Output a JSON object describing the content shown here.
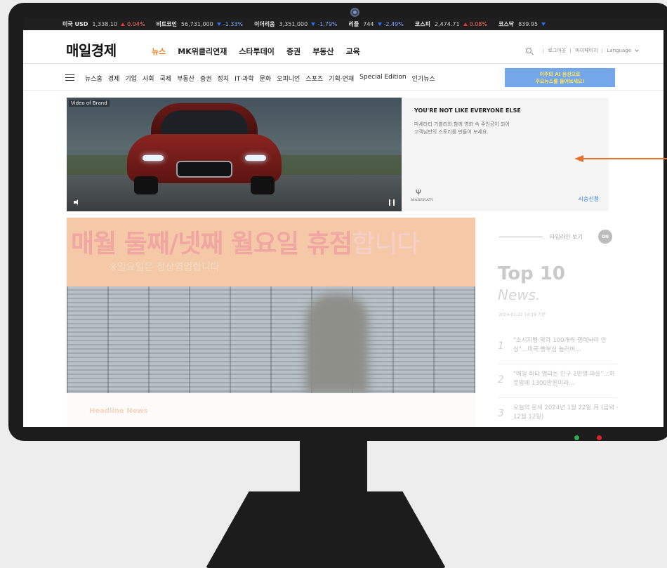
{
  "ticker": [
    {
      "name": "미국 USD",
      "value": "1,338.10",
      "change": "0.04%",
      "dir": "up"
    },
    {
      "name": "비트코인",
      "value": "56,731,000",
      "change": "-1.33%",
      "dir": "down"
    },
    {
      "name": "이더리움",
      "value": "3,351,000",
      "change": "-1.79%",
      "dir": "down"
    },
    {
      "name": "리플",
      "value": "744",
      "change": "-2.49%",
      "dir": "down"
    },
    {
      "name": "코스피",
      "value": "2,474.71",
      "change": "0.08%",
      "dir": "up"
    },
    {
      "name": "코스닥",
      "value": "839.95",
      "change": "",
      "dir": "down"
    }
  ],
  "header": {
    "logo": "매일경제",
    "nav": [
      "뉴스",
      "MK위클리연재",
      "스타투데이",
      "증권",
      "부동산",
      "교육"
    ],
    "active_nav": 0,
    "logout": "로그아웃",
    "mypage": "마이페이지",
    "language": "Language"
  },
  "subnav": {
    "items": [
      "뉴스홈",
      "경제",
      "기업",
      "사회",
      "국제",
      "부동산",
      "증권",
      "정치",
      "IT·과학",
      "문화",
      "오피니언",
      "스포츠",
      "기획·연재",
      "Special Edition",
      "인기뉴스"
    ],
    "banner_line1": "이주의 AI 음성으로",
    "banner_line2": "주요뉴스를 들어보세요!"
  },
  "ad": {
    "video_tag": "Video of Brand",
    "title": "YOU'RE NOT LIKE EVERYONE ELSE",
    "text_line1": "마세라티 기블리와 함께 영화 속 주인공이 되어",
    "text_line2": "고객님만의 스토리를 만들어 보세요.",
    "brand_icon": "Ψ",
    "brand": "MASERATI",
    "cta": "시승신청"
  },
  "hero": {
    "headline": "매월 둘째/넷째 월요일 휴점",
    "headline_tail": "합니다",
    "subline": "※일요일은 정상영업합니다",
    "section_label": "Headline News"
  },
  "sidebar": {
    "timeline_label": "타임라인 보기",
    "toggle": "ON",
    "top_title": "Top 10",
    "top_sub": "News.",
    "timestamp": "2024-01-22 14:19 기준",
    "items": [
      {
        "rank": "1",
        "title": "\"소시지빵·약과 100개씩 쟁여놔야 안심\"…미국 빵부심 놀러버…"
      },
      {
        "rank": "2",
        "title": "\"매일 파티 열리는 인구 1만명 마을\"…하룻밤에 1300만원이라…"
      },
      {
        "rank": "3",
        "title": "오늘의 운세 2024년 1월 22일 月 (음력 12월 12일)"
      }
    ]
  },
  "colors": {
    "accent": "#f2801f",
    "link": "#2f7be6",
    "arrow": "#e8702a",
    "up": "#e0322d",
    "down": "#2f6fe6"
  }
}
